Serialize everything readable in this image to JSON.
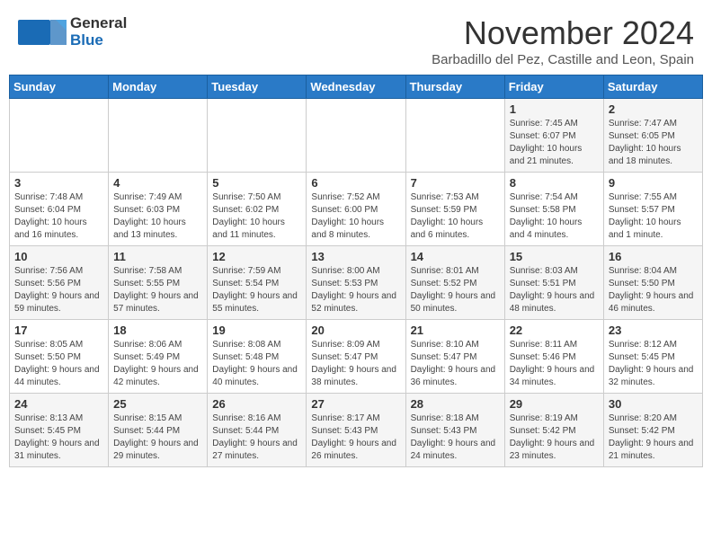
{
  "header": {
    "logo_general": "General",
    "logo_blue": "Blue",
    "month": "November 2024",
    "location": "Barbadillo del Pez, Castille and Leon, Spain"
  },
  "weekdays": [
    "Sunday",
    "Monday",
    "Tuesday",
    "Wednesday",
    "Thursday",
    "Friday",
    "Saturday"
  ],
  "weeks": [
    [
      {
        "day": "",
        "info": ""
      },
      {
        "day": "",
        "info": ""
      },
      {
        "day": "",
        "info": ""
      },
      {
        "day": "",
        "info": ""
      },
      {
        "day": "",
        "info": ""
      },
      {
        "day": "1",
        "info": "Sunrise: 7:45 AM\nSunset: 6:07 PM\nDaylight: 10 hours and 21 minutes."
      },
      {
        "day": "2",
        "info": "Sunrise: 7:47 AM\nSunset: 6:05 PM\nDaylight: 10 hours and 18 minutes."
      }
    ],
    [
      {
        "day": "3",
        "info": "Sunrise: 7:48 AM\nSunset: 6:04 PM\nDaylight: 10 hours and 16 minutes."
      },
      {
        "day": "4",
        "info": "Sunrise: 7:49 AM\nSunset: 6:03 PM\nDaylight: 10 hours and 13 minutes."
      },
      {
        "day": "5",
        "info": "Sunrise: 7:50 AM\nSunset: 6:02 PM\nDaylight: 10 hours and 11 minutes."
      },
      {
        "day": "6",
        "info": "Sunrise: 7:52 AM\nSunset: 6:00 PM\nDaylight: 10 hours and 8 minutes."
      },
      {
        "day": "7",
        "info": "Sunrise: 7:53 AM\nSunset: 5:59 PM\nDaylight: 10 hours and 6 minutes."
      },
      {
        "day": "8",
        "info": "Sunrise: 7:54 AM\nSunset: 5:58 PM\nDaylight: 10 hours and 4 minutes."
      },
      {
        "day": "9",
        "info": "Sunrise: 7:55 AM\nSunset: 5:57 PM\nDaylight: 10 hours and 1 minute."
      }
    ],
    [
      {
        "day": "10",
        "info": "Sunrise: 7:56 AM\nSunset: 5:56 PM\nDaylight: 9 hours and 59 minutes."
      },
      {
        "day": "11",
        "info": "Sunrise: 7:58 AM\nSunset: 5:55 PM\nDaylight: 9 hours and 57 minutes."
      },
      {
        "day": "12",
        "info": "Sunrise: 7:59 AM\nSunset: 5:54 PM\nDaylight: 9 hours and 55 minutes."
      },
      {
        "day": "13",
        "info": "Sunrise: 8:00 AM\nSunset: 5:53 PM\nDaylight: 9 hours and 52 minutes."
      },
      {
        "day": "14",
        "info": "Sunrise: 8:01 AM\nSunset: 5:52 PM\nDaylight: 9 hours and 50 minutes."
      },
      {
        "day": "15",
        "info": "Sunrise: 8:03 AM\nSunset: 5:51 PM\nDaylight: 9 hours and 48 minutes."
      },
      {
        "day": "16",
        "info": "Sunrise: 8:04 AM\nSunset: 5:50 PM\nDaylight: 9 hours and 46 minutes."
      }
    ],
    [
      {
        "day": "17",
        "info": "Sunrise: 8:05 AM\nSunset: 5:50 PM\nDaylight: 9 hours and 44 minutes."
      },
      {
        "day": "18",
        "info": "Sunrise: 8:06 AM\nSunset: 5:49 PM\nDaylight: 9 hours and 42 minutes."
      },
      {
        "day": "19",
        "info": "Sunrise: 8:08 AM\nSunset: 5:48 PM\nDaylight: 9 hours and 40 minutes."
      },
      {
        "day": "20",
        "info": "Sunrise: 8:09 AM\nSunset: 5:47 PM\nDaylight: 9 hours and 38 minutes."
      },
      {
        "day": "21",
        "info": "Sunrise: 8:10 AM\nSunset: 5:47 PM\nDaylight: 9 hours and 36 minutes."
      },
      {
        "day": "22",
        "info": "Sunrise: 8:11 AM\nSunset: 5:46 PM\nDaylight: 9 hours and 34 minutes."
      },
      {
        "day": "23",
        "info": "Sunrise: 8:12 AM\nSunset: 5:45 PM\nDaylight: 9 hours and 32 minutes."
      }
    ],
    [
      {
        "day": "24",
        "info": "Sunrise: 8:13 AM\nSunset: 5:45 PM\nDaylight: 9 hours and 31 minutes."
      },
      {
        "day": "25",
        "info": "Sunrise: 8:15 AM\nSunset: 5:44 PM\nDaylight: 9 hours and 29 minutes."
      },
      {
        "day": "26",
        "info": "Sunrise: 8:16 AM\nSunset: 5:44 PM\nDaylight: 9 hours and 27 minutes."
      },
      {
        "day": "27",
        "info": "Sunrise: 8:17 AM\nSunset: 5:43 PM\nDaylight: 9 hours and 26 minutes."
      },
      {
        "day": "28",
        "info": "Sunrise: 8:18 AM\nSunset: 5:43 PM\nDaylight: 9 hours and 24 minutes."
      },
      {
        "day": "29",
        "info": "Sunrise: 8:19 AM\nSunset: 5:42 PM\nDaylight: 9 hours and 23 minutes."
      },
      {
        "day": "30",
        "info": "Sunrise: 8:20 AM\nSunset: 5:42 PM\nDaylight: 9 hours and 21 minutes."
      }
    ]
  ]
}
